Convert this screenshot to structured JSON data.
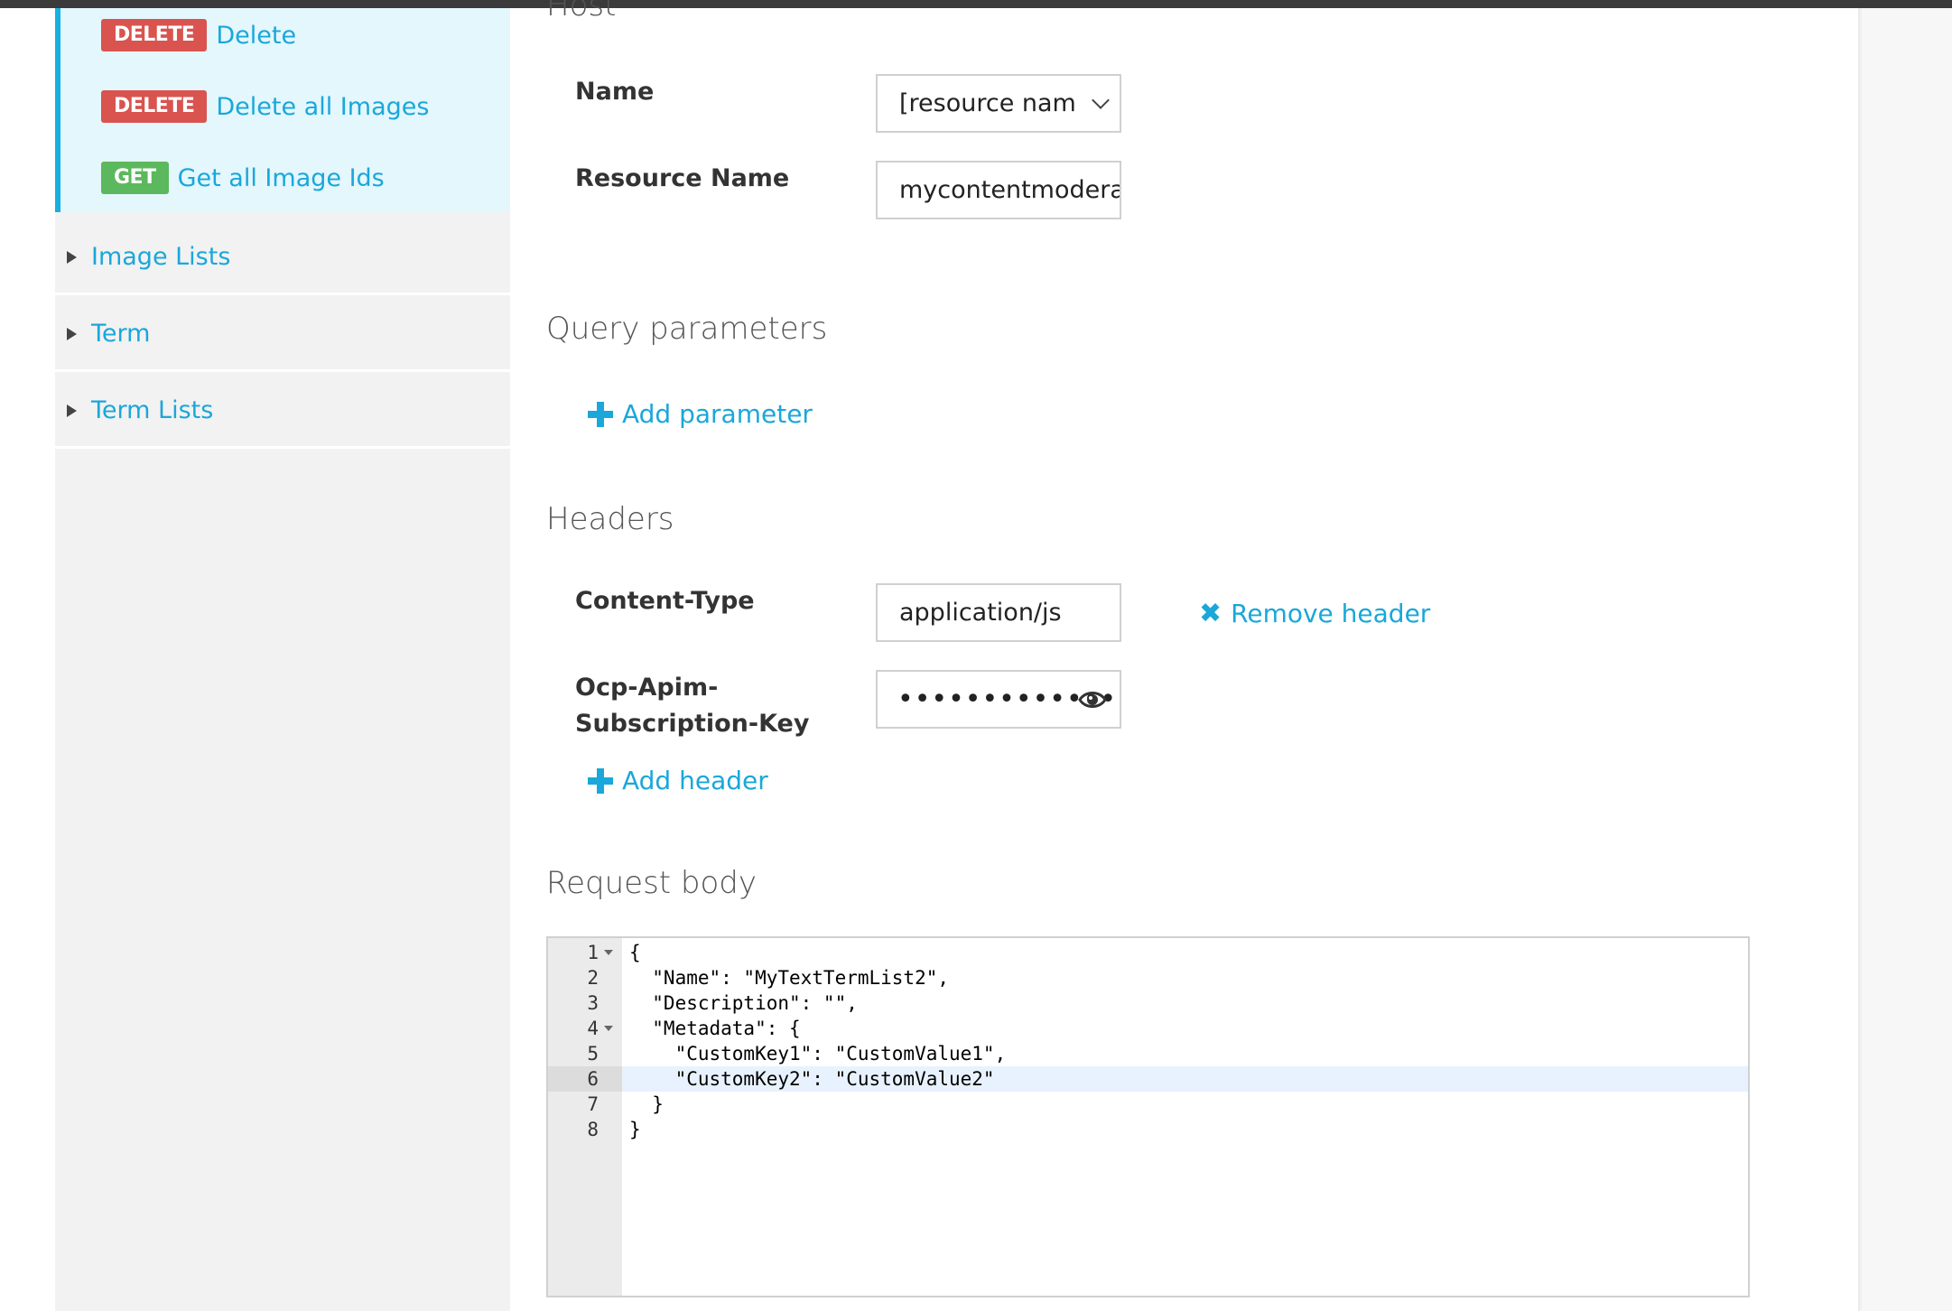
{
  "sidebar": {
    "operations": [
      {
        "method": "DELETE",
        "label": "Delete"
      },
      {
        "method": "DELETE",
        "label": "Delete all Images"
      },
      {
        "method": "GET",
        "label": "Get all Image Ids"
      }
    ],
    "groups": [
      {
        "label": "Image Lists"
      },
      {
        "label": "Term"
      },
      {
        "label": "Term Lists"
      }
    ]
  },
  "host": {
    "title": "Host",
    "name_label": "Name",
    "name_value": "[resource nam",
    "resource_label": "Resource Name",
    "resource_value": "mycontentmodera"
  },
  "query": {
    "title": "Query parameters",
    "add_label": "Add parameter"
  },
  "headers": {
    "title": "Headers",
    "content_type_label": "Content-Type",
    "content_type_value": "application/js",
    "remove_label": "Remove header",
    "key_label": "Ocp-Apim-Subscription-Key",
    "key_value": "••••••••••••••",
    "add_label": "Add header"
  },
  "body": {
    "title": "Request body",
    "lines": [
      {
        "n": "1",
        "text": "{"
      },
      {
        "n": "2",
        "text": "  \"Name\": \"MyTextTermList2\","
      },
      {
        "n": "3",
        "text": "  \"Description\": \"\","
      },
      {
        "n": "4",
        "text": "  \"Metadata\": {"
      },
      {
        "n": "5",
        "text": "    \"CustomKey1\": \"CustomValue1\","
      },
      {
        "n": "6",
        "text": "    \"CustomKey2\": \"CustomValue2\""
      },
      {
        "n": "7",
        "text": "  }"
      },
      {
        "n": "8",
        "text": "}"
      }
    ]
  },
  "colors": {
    "accent": "#1aa7da",
    "delete_badge": "#d9534f",
    "get_badge": "#5cb85c",
    "active_panel": "#e3f7fd"
  }
}
